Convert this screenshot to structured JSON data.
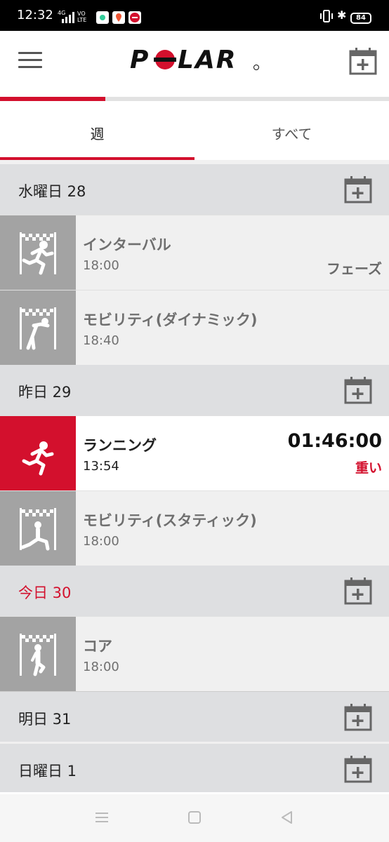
{
  "status_bar": {
    "time": "12:32",
    "network": "4G",
    "volte": "VO\nLTE",
    "battery": "84"
  },
  "header": {
    "logo_text": "POLAR",
    "progress_fraction": 0.27
  },
  "tabs": [
    {
      "label": "週",
      "active": true
    },
    {
      "label": "すべて",
      "active": false
    }
  ],
  "days": [
    {
      "title": "水曜日 28",
      "today": false,
      "entries": [
        {
          "name": "インターバル",
          "time": "18:00",
          "tag": "フェーズ",
          "icon": "interval-run-icon",
          "done": false
        },
        {
          "name": "モビリティ(ダイナミック)",
          "time": "18:40",
          "tag": "",
          "icon": "mobility-dynamic-icon",
          "done": false
        }
      ]
    },
    {
      "title": "昨日 29",
      "today": false,
      "entries": [
        {
          "name": "ランニング",
          "time": "13:54",
          "duration": "01:46:00",
          "load": "重い",
          "icon": "running-icon",
          "done": true
        },
        {
          "name": "モビリティ(スタティック)",
          "time": "18:00",
          "tag": "",
          "icon": "mobility-static-icon",
          "done": false
        }
      ]
    },
    {
      "title": "今日 30",
      "today": true,
      "entries": [
        {
          "name": "コア",
          "time": "18:00",
          "tag": "",
          "icon": "core-icon",
          "done": false
        }
      ]
    },
    {
      "title": "明日 31",
      "today": false,
      "entries": []
    },
    {
      "title": "日曜日 1",
      "today": false,
      "entries": []
    }
  ],
  "colors": {
    "accent": "#d3102d",
    "header_gray": "#dedfe1",
    "thumb_gray": "#a3a3a3"
  }
}
